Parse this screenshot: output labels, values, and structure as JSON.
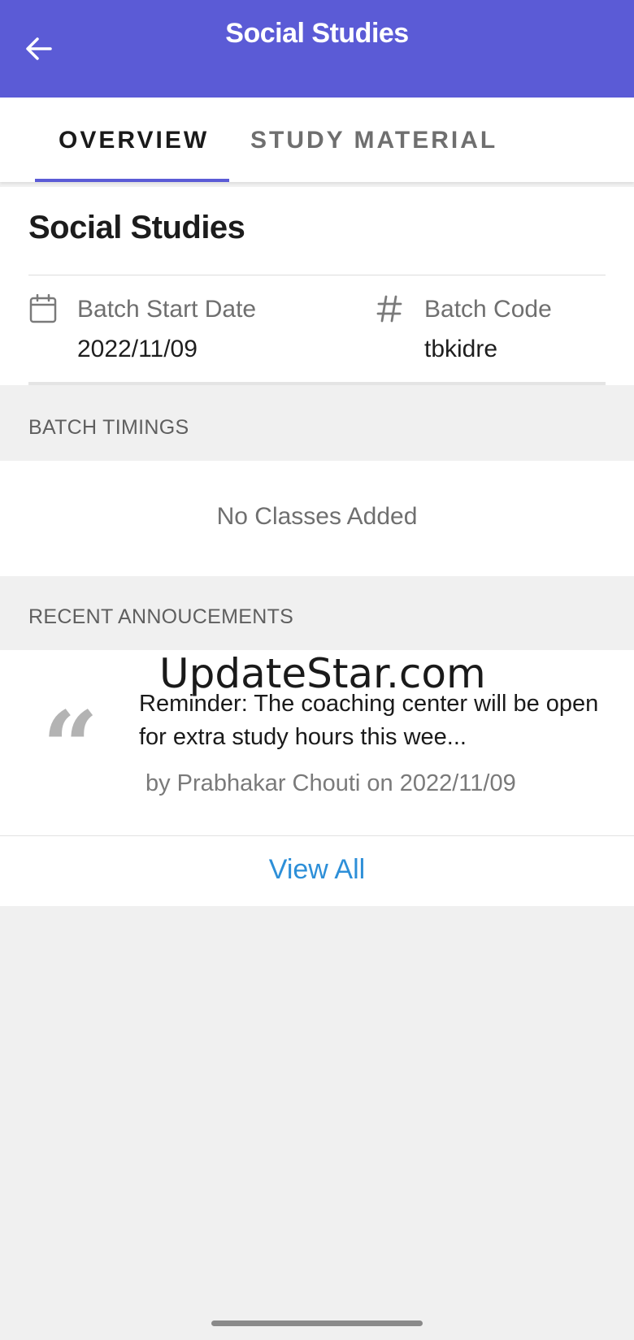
{
  "appbar": {
    "title": "Social Studies"
  },
  "tabs": [
    {
      "label": "OVERVIEW",
      "active": true
    },
    {
      "label": "STUDY MATERIAL",
      "active": false
    }
  ],
  "overview": {
    "course_title": "Social Studies",
    "batch_start": {
      "label": "Batch Start Date",
      "value": "2022/11/09",
      "icon": "calendar-icon"
    },
    "batch_code": {
      "label": "Batch Code",
      "value": "tbkidre",
      "icon": "hash-icon"
    }
  },
  "timings": {
    "header": "BATCH TIMINGS",
    "empty_text": "No Classes Added"
  },
  "announcements": {
    "header": "RECENT ANNOUCEMENTS",
    "items": [
      {
        "text": "Reminder: The coaching center will be open for extra study hours this wee...",
        "meta": "by Prabhakar Chouti on 2022/11/09"
      }
    ],
    "view_all_label": "View All"
  },
  "watermark": "UpdateStar.com",
  "colors": {
    "primary": "#5b5bd6",
    "link": "#2d8fd8",
    "background": "#f0f0f0"
  }
}
